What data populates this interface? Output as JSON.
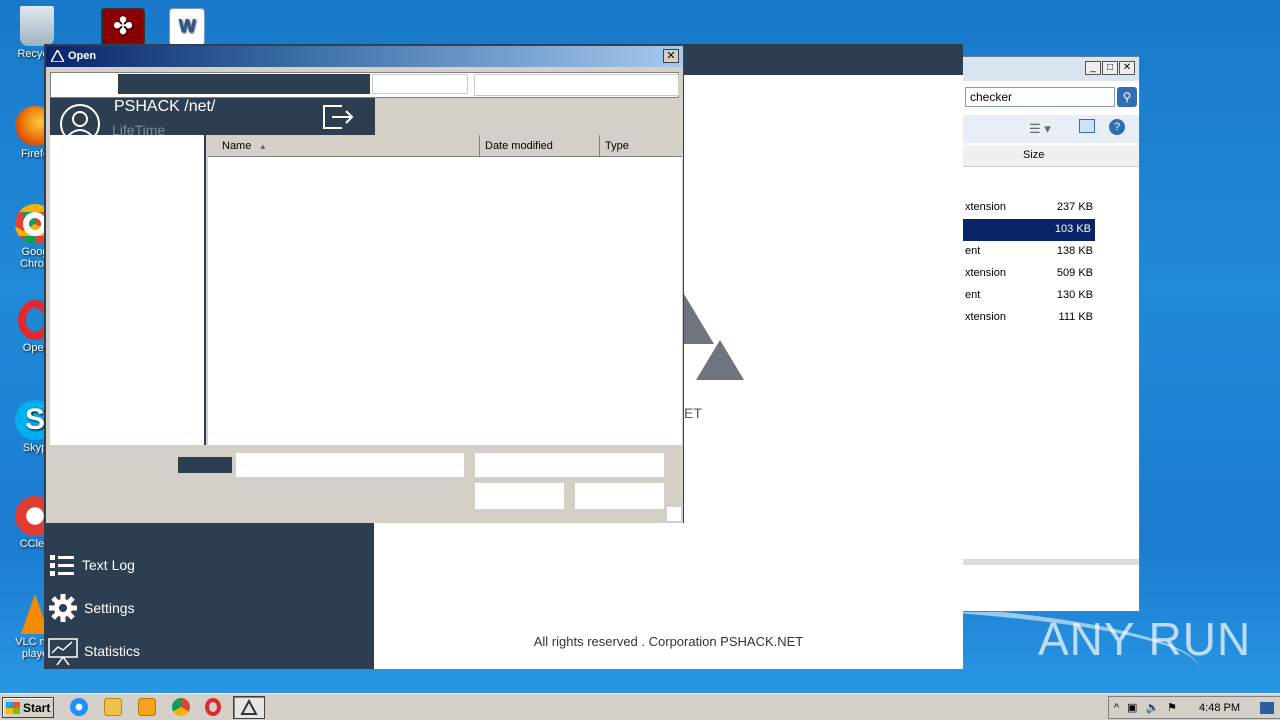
{
  "desktop": {
    "icons": [
      {
        "label": "Recycle",
        "name": "recycle-bin"
      },
      {
        "label": "Firefo",
        "name": "firefox"
      },
      {
        "label": "Goog Chron",
        "name": "google-chrome"
      },
      {
        "label": "Oper",
        "name": "opera"
      },
      {
        "label": "Skyp",
        "name": "skype"
      },
      {
        "label": "CClea",
        "name": "ccleaner"
      },
      {
        "label": "VLC me playe",
        "name": "vlc"
      }
    ]
  },
  "explorer": {
    "address": "checker",
    "column_size": "Size",
    "rows": [
      {
        "type": "xtension",
        "size": "237 KB"
      },
      {
        "type": "",
        "size": "103 KB"
      },
      {
        "type": "ent",
        "size": "138 KB"
      },
      {
        "type": "xtension",
        "size": "509 KB"
      },
      {
        "type": "ent",
        "size": "130 KB"
      },
      {
        "type": "xtension",
        "size": "111 KB"
      }
    ]
  },
  "app": {
    "user_name": "PSHACK /net/",
    "license": "LifeTime",
    "menu": {
      "text_log": "Text Log",
      "settings": "Settings",
      "statistics": "Statistics"
    },
    "brand_fragment": "ET",
    "footer": "All rights reserved . Corporation PSHACK.NET"
  },
  "dialog": {
    "title": "Open",
    "columns": {
      "name": "Name",
      "date_modified": "Date modified",
      "type": "Type"
    }
  },
  "watermark": "ANY RUN",
  "taskbar": {
    "start": "Start",
    "time": "4:48 PM"
  }
}
